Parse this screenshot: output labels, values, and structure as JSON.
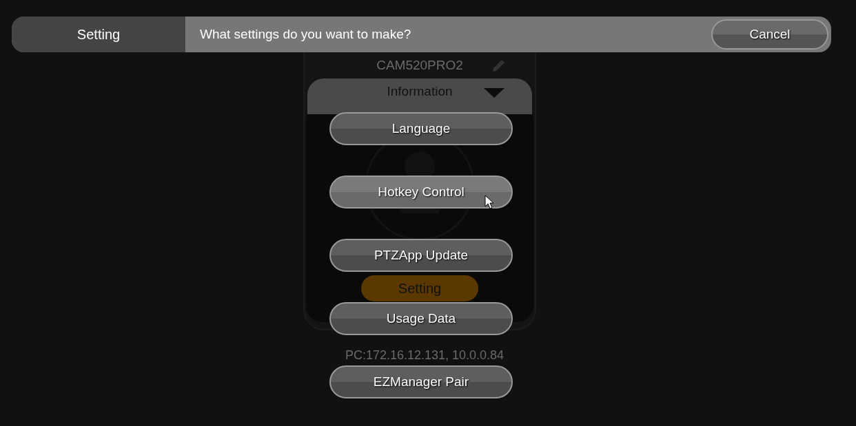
{
  "header": {
    "title": "Setting",
    "prompt": "What settings do you want to make?",
    "cancel": "Cancel"
  },
  "device": {
    "name": "CAM520PRO2",
    "section": "Information",
    "action": "Setting",
    "address": "PC:172.16.12.131, 10.0.0.84"
  },
  "options": [
    {
      "label": "Language",
      "hovered": false
    },
    {
      "label": "Hotkey Control",
      "hovered": true
    },
    {
      "label": "PTZApp Update",
      "hovered": false
    },
    {
      "label": "Usage Data",
      "hovered": false
    },
    {
      "label": "EZManager Pair",
      "hovered": false
    }
  ]
}
